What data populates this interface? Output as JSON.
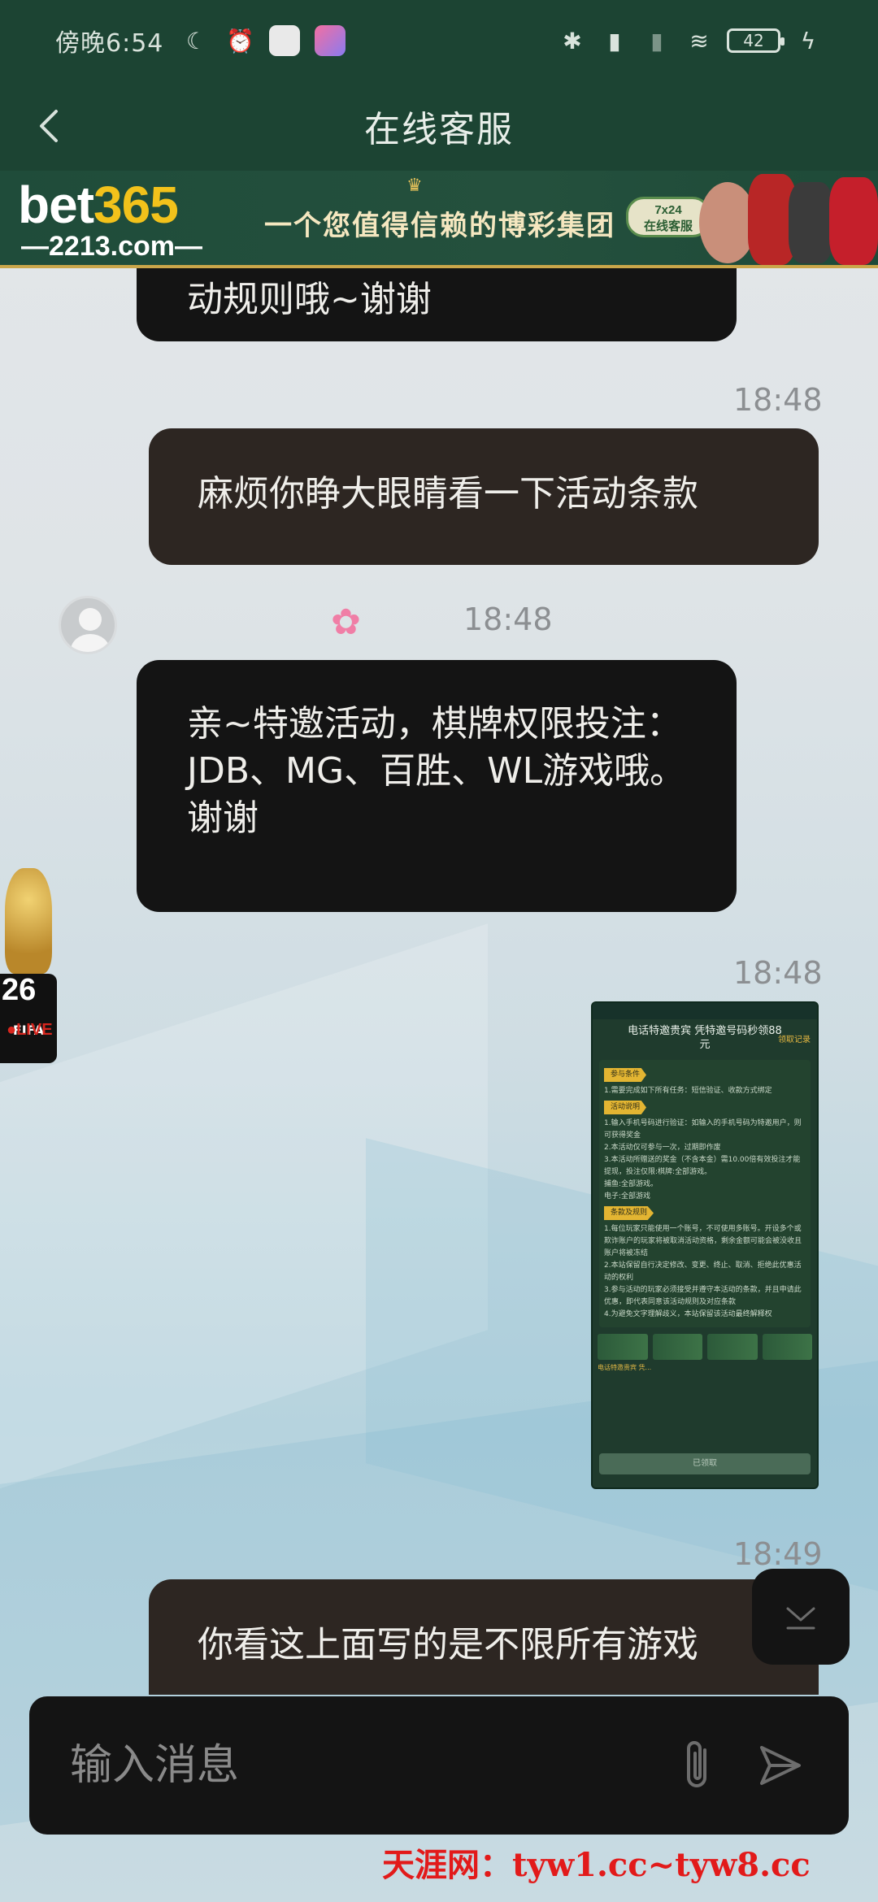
{
  "status_bar": {
    "time": "傍晚6:54",
    "battery": "42"
  },
  "header": {
    "title": "在线客服"
  },
  "banner": {
    "logo_main": "bet",
    "logo_num": "365",
    "logo_domain": "—2213.com—",
    "slogan": "一个您值得信赖的博彩集团",
    "service_line1": "7x24",
    "service_line2": "在线客服"
  },
  "messages": [
    {
      "type": "incoming",
      "text": "动规则哦~谢谢"
    },
    {
      "type": "outgoing",
      "time": "18:48",
      "text": "麻烦你睁大眼睛看一下活动条款"
    },
    {
      "type": "incoming",
      "time": "18:48",
      "text": "亲~特邀活动，棋牌权限投注：JDB、MG、百胜、WL游戏哦。谢谢"
    },
    {
      "type": "image",
      "time": "18:48"
    },
    {
      "type": "outgoing",
      "time": "18:49",
      "text": "你看这上面写的是不限所有游戏"
    }
  ],
  "shared_image": {
    "title": "电话特邀贵宾 凭特邀号码秒领88元",
    "link": "领取记录",
    "tag1": "参与条件",
    "line1": "1.需要完成如下所有任务：短信验证、收款方式绑定",
    "tag2": "活动说明",
    "line2": "1.输入手机号码进行验证：如输入的手机号码为特邀用户，则可获得奖金",
    "line3": "2.本活动仅可参与一次，过期即作废",
    "line4": "3.本活动所赠送的奖金（不含本金）需10.00倍有效投注才能提现，投注仅限:棋牌:全部游戏。",
    "line5": "捕鱼:全部游戏。",
    "line6": "电子:全部游戏",
    "tag3": "条款及规则",
    "line7": "1.每位玩家只能使用一个账号，不可使用多账号。开设多个或欺诈账户的玩家将被取消活动资格，剩余金额可能会被没收且账户将被冻结",
    "line8": "2.本站保留自行决定修改、变更、终止、取消、拒绝此优惠活动的权利",
    "line9": "3.参与活动的玩家必须接受并遵守本活动的条款，并且申请此优惠，即代表同意该活动规则及对应条款",
    "line10": "4.为避免文字理解歧义，本站保留该活动最终解释权",
    "cap1": "电话特邀贵宾 凭...",
    "button": "已领取"
  },
  "fifa": {
    "label": "FIFA",
    "year": "26",
    "live": "●LIVE"
  },
  "input": {
    "placeholder": "输入消息"
  },
  "watermark": "天涯网：tyw1.cc~tyw8.cc",
  "colors": {
    "header_bg": "#1c4433",
    "incoming_bubble": "#141414",
    "outgoing_bubble": "#2d2622",
    "timestamp": "#8c8f92"
  }
}
